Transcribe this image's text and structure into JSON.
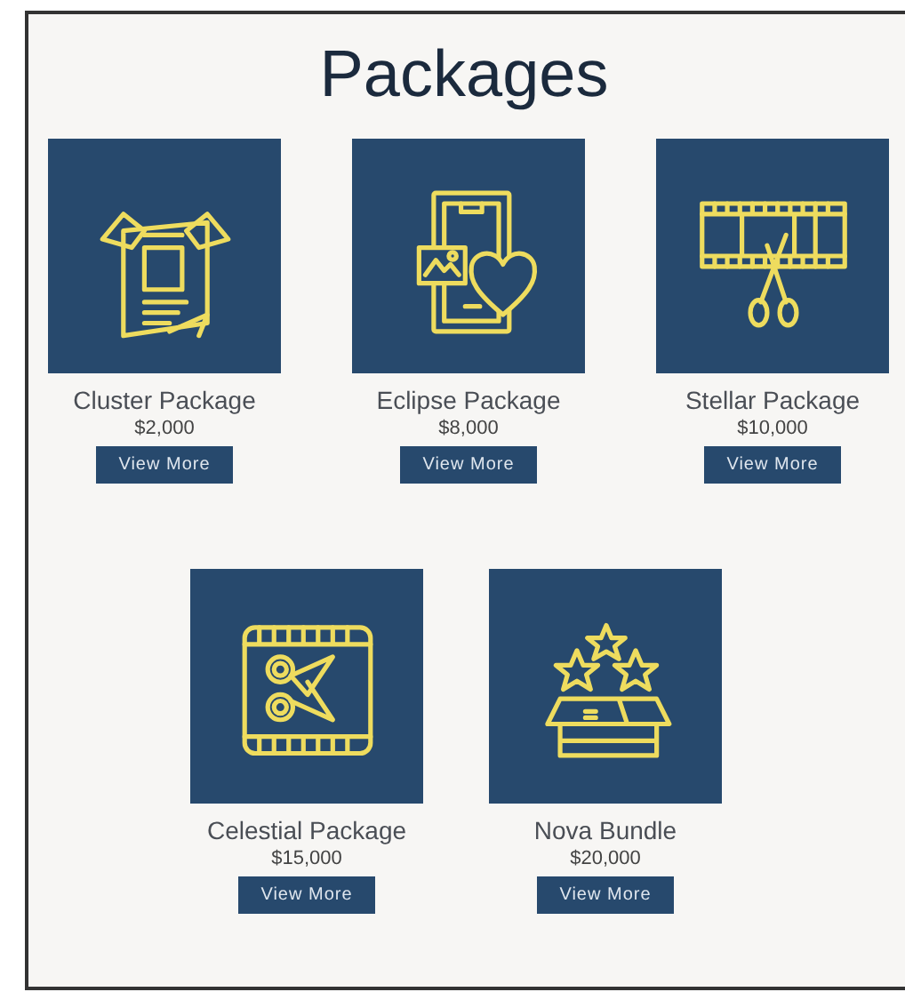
{
  "title": "Packages",
  "rows": [
    [
      {
        "kind": "poster",
        "name": "Cluster Package",
        "price": "$2,000",
        "button": "View More"
      },
      {
        "kind": "phone",
        "name": "Eclipse Package",
        "price": "$8,000",
        "button": "View More"
      },
      {
        "kind": "filmstrip",
        "name": "Stellar Package",
        "price": "$10,000",
        "button": "View More"
      }
    ],
    [
      {
        "kind": "cutting",
        "name": "Celestial Package",
        "price": "$15,000",
        "button": "View More"
      },
      {
        "kind": "gift",
        "name": "Nova Bundle",
        "price": "$20,000",
        "button": "View More"
      }
    ]
  ]
}
